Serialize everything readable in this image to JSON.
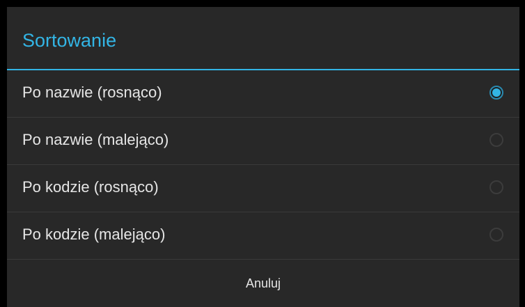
{
  "dialog": {
    "title": "Sortowanie",
    "options": [
      {
        "label": "Po nazwie (rosnąco)",
        "selected": true
      },
      {
        "label": "Po nazwie (malejąco)",
        "selected": false
      },
      {
        "label": "Po kodzie (rosnąco)",
        "selected": false
      },
      {
        "label": "Po kodzie (malejąco)",
        "selected": false
      }
    ],
    "cancel_label": "Anuluj"
  },
  "colors": {
    "accent": "#33b5e5",
    "dialog_background": "#282828",
    "text": "#e6e6e6",
    "divider": "#3a3a3a"
  }
}
